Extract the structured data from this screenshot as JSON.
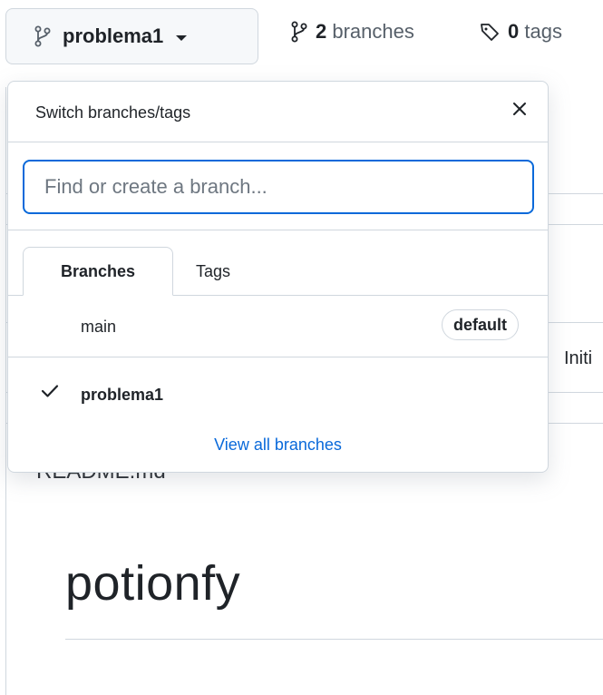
{
  "top_bar": {
    "current_branch": "problema1",
    "branches_count": "2",
    "branches_label": "branches",
    "tags_count": "0",
    "tags_label": "tags",
    "icons": [
      "git-branch-icon",
      "caret-down-icon",
      "tag-icon"
    ]
  },
  "dropdown": {
    "title": "Switch branches/tags",
    "close_icon": "x-icon",
    "search_placeholder": "Find or create a branch...",
    "tabs": [
      {
        "label": "Branches",
        "active": true
      },
      {
        "label": "Tags",
        "active": false
      }
    ],
    "branches": [
      {
        "name": "main",
        "badge": "default",
        "selected": false
      },
      {
        "name": "problema1",
        "badge": "",
        "selected": true
      }
    ],
    "view_all_label": "View all branches"
  },
  "background": {
    "commit_fragment": "Initi",
    "readme_file": "README.md",
    "readme_title": "potionfy"
  },
  "colors": {
    "accent": "#0969da",
    "border": "#d0d7de",
    "text": "#1f2328",
    "muted": "#57606a"
  }
}
